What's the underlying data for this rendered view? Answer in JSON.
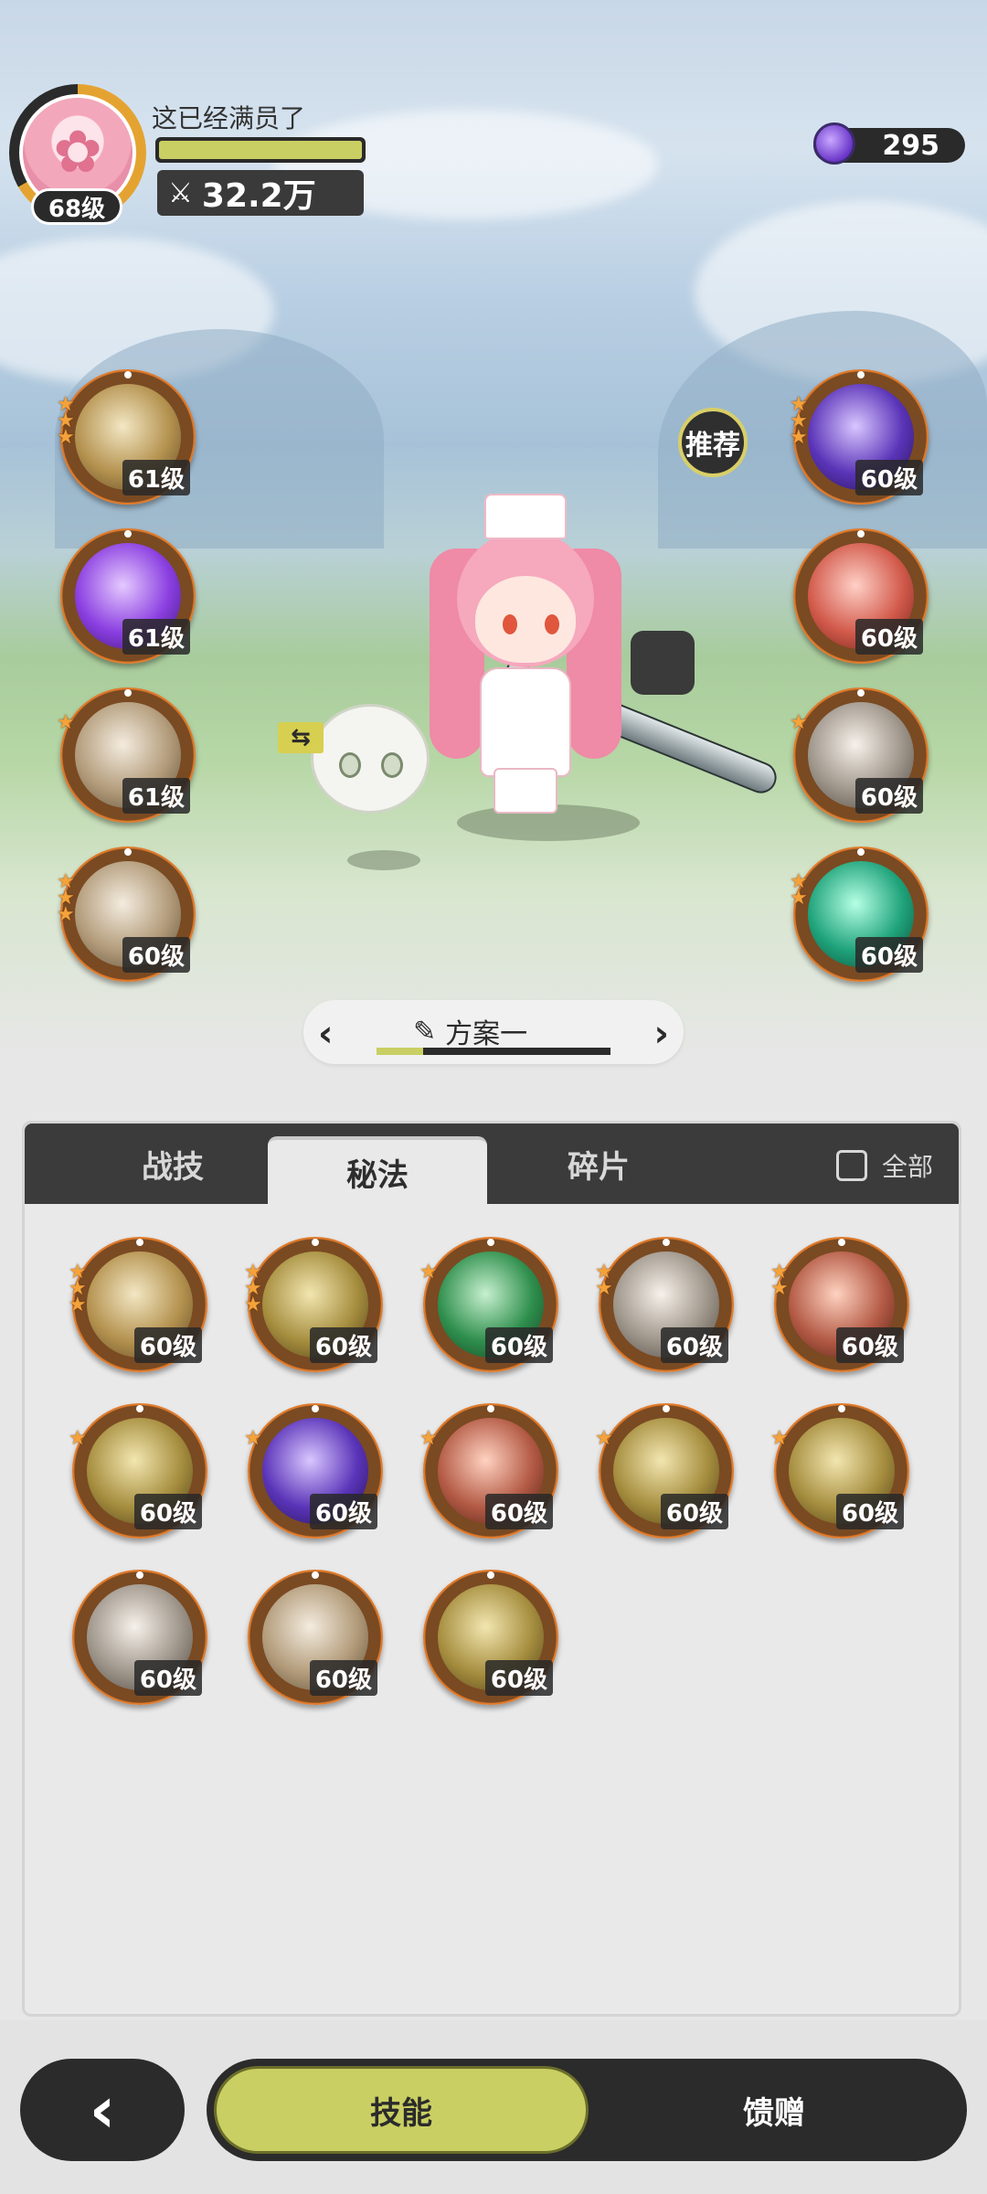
{
  "header": {
    "player_name": "这已经满员了",
    "level": "68级",
    "power": "32.2万",
    "hp_fraction": 1.0,
    "gems": "295",
    "icons": [
      "avatar",
      "power-icon",
      "gem-icon"
    ]
  },
  "recommend_label": "推荐",
  "left_skills": [
    {
      "level": "61级",
      "stars": 3,
      "icon": "swirl",
      "color": "c-gold"
    },
    {
      "level": "61级",
      "stars": 0,
      "icon": "purple-flame",
      "color": "c-purple"
    },
    {
      "level": "61级",
      "stars": 1,
      "icon": "cyclone",
      "color": "c-tan"
    },
    {
      "level": "60级",
      "stars": 3,
      "icon": "slash",
      "color": "c-tan"
    }
  ],
  "right_skills": [
    {
      "level": "60级",
      "stars": 3,
      "icon": "purple-orb",
      "color": "c-violet"
    },
    {
      "level": "60级",
      "stars": 0,
      "icon": "red-sword",
      "color": "c-red"
    },
    {
      "level": "60级",
      "stars": 1,
      "icon": "sword-up",
      "color": "c-gray"
    },
    {
      "level": "60级",
      "stars": 2,
      "icon": "teal-sword",
      "color": "c-teal"
    }
  ],
  "preset": {
    "label": "方案一",
    "prev_icon": "chevron-left-icon",
    "next_icon": "chevron-right-icon",
    "progress_fraction": 0.2
  },
  "tabs": [
    {
      "label": "战技",
      "active": false
    },
    {
      "label": "秘法",
      "active": true
    },
    {
      "label": "碎片",
      "active": false
    }
  ],
  "all_toggle_label": "全部",
  "grid_skills": [
    {
      "level": "60级",
      "stars": 3,
      "color": "c-gold"
    },
    {
      "level": "60级",
      "stars": 3,
      "color": "c-olive"
    },
    {
      "level": "60级",
      "stars": 1,
      "color": "c-green"
    },
    {
      "level": "60级",
      "stars": 2,
      "color": "c-gray"
    },
    {
      "level": "60级",
      "stars": 2,
      "color": "c-copper"
    },
    {
      "level": "60级",
      "stars": 1,
      "color": "c-olive"
    },
    {
      "level": "60级",
      "stars": 1,
      "color": "c-violet"
    },
    {
      "level": "60级",
      "stars": 1,
      "color": "c-copper"
    },
    {
      "level": "60级",
      "stars": 1,
      "color": "c-olive"
    },
    {
      "level": "60级",
      "stars": 1,
      "color": "c-olive"
    },
    {
      "level": "60级",
      "stars": 0,
      "color": "c-gray"
    },
    {
      "level": "60级",
      "stars": 0,
      "color": "c-tan"
    },
    {
      "level": "60级",
      "stars": 0,
      "color": "c-olive"
    }
  ],
  "bottom": {
    "back_icon": "chevron-left-icon",
    "skills_label": "技能",
    "gift_label": "馈赠"
  }
}
